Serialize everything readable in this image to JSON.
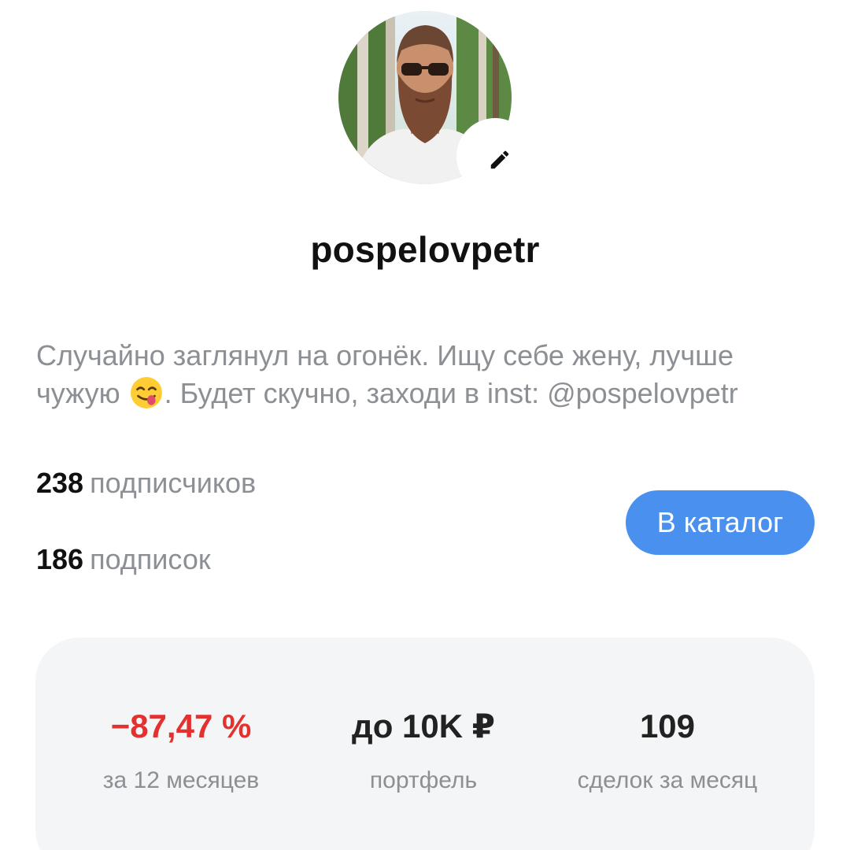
{
  "profile": {
    "username": "pospelovpetr",
    "avatar_icon": "user-photo",
    "edit_icon": "pencil-icon",
    "bio_part1": "Случайно заглянул на огонёк. Ищу себе жену, лучше чужую",
    "bio_emoji": "face-savoring-food-emoji",
    "bio_part2": ". Будет скучно, заходи в inst: @pospelovpetr"
  },
  "counters": {
    "followers_count": "238",
    "followers_label": "подписчиков",
    "following_count": "186",
    "following_label": "подписок"
  },
  "catalog_button": {
    "label": "В каталог",
    "color": "#4a90ee"
  },
  "stats": [
    {
      "value": "−87,47 %",
      "caption": "за 12 месяцев",
      "color": "#e3312f"
    },
    {
      "value": "до 10K ₽",
      "caption": "портфель"
    },
    {
      "value": "109",
      "caption": "сделок за месяц"
    }
  ]
}
